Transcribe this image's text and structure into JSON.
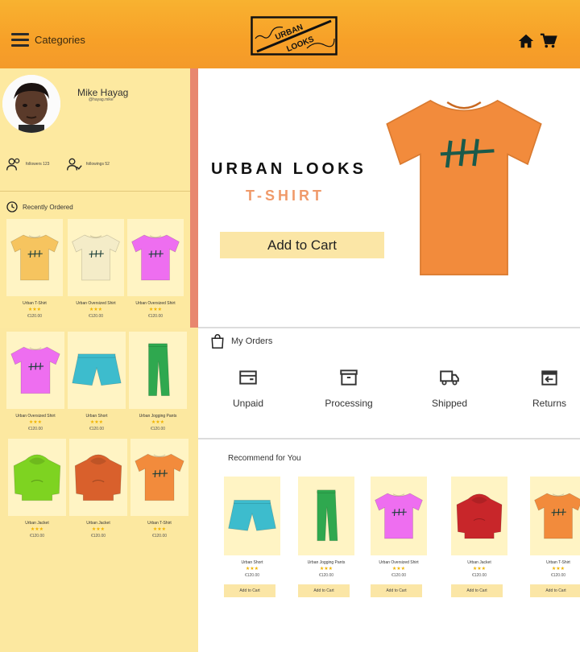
{
  "header": {
    "menu_label": "Categories",
    "logo_text_top": "URBAN",
    "logo_text_bottom": "LOOKS"
  },
  "profile": {
    "name": "Mike Hayag",
    "handle": "@hayag.mike",
    "followers": "followers 123",
    "followings": "followings 52"
  },
  "recently_ordered": {
    "title": "Recently Ordered",
    "items": [
      {
        "name": "Urban T-Shirt",
        "stars": "★★★",
        "price": "€120.00",
        "color": "#f6c45f",
        "kind": "tshirt"
      },
      {
        "name": "Urban Oversized Shirt",
        "stars": "★★★",
        "price": "€120.00",
        "color": "#f4ecc8",
        "kind": "tshirt"
      },
      {
        "name": "Urban Oversized Shirt",
        "stars": "★★★",
        "price": "€120.00",
        "color": "#ee6ef0",
        "kind": "tshirt"
      }
    ]
  },
  "more_items": [
    {
      "name": "Urban Oversized Shirt",
      "stars": "★★★",
      "price": "€120.00",
      "color": "#ee6ef0",
      "kind": "tshirt"
    },
    {
      "name": "Urban Short",
      "stars": "★★★",
      "price": "€120.00",
      "color": "#3dbccd",
      "kind": "shorts"
    },
    {
      "name": "Urban Jogging Pants",
      "stars": "★★★",
      "price": "€120.00",
      "color": "#2fa84f",
      "kind": "pants"
    },
    {
      "name": "Urban Jacket",
      "stars": "★★★",
      "price": "€120.00",
      "color": "#7ed321",
      "kind": "hoodie"
    },
    {
      "name": "Urban Jacket",
      "stars": "★★★",
      "price": "€120.00",
      "color": "#d9602c",
      "kind": "hoodie"
    },
    {
      "name": "Urban T-Shirt",
      "stars": "★★★",
      "price": "€120.00",
      "color": "#f28b3c",
      "kind": "tshirt"
    }
  ],
  "hero": {
    "title": "URBAN LOOKS",
    "subtitle": "T-SHIRT",
    "button": "Add to Cart",
    "shirt_color": "#f28b3c"
  },
  "orders": {
    "title": "My Orders",
    "items": [
      {
        "label": "Unpaid",
        "icon": "wallet-icon"
      },
      {
        "label": "Processing",
        "icon": "box-icon"
      },
      {
        "label": "Shipped",
        "icon": "truck-icon"
      },
      {
        "label": "Returns",
        "icon": "return-icon"
      }
    ]
  },
  "recommend": {
    "title": "Recommend for You",
    "button": "Add to Cart",
    "items": [
      {
        "name": "Urban Short",
        "stars": "★★★",
        "price": "€120.00",
        "color": "#3dbccd",
        "kind": "shorts"
      },
      {
        "name": "Urban Jogging Pants",
        "stars": "★★★",
        "price": "€120.00",
        "color": "#2fa84f",
        "kind": "pants"
      },
      {
        "name": "Urban Oversized Shirt",
        "stars": "★★★",
        "price": "€120.00",
        "color": "#ee6ef0",
        "kind": "tshirt"
      },
      {
        "name": "Urban Jacket",
        "stars": "★★★",
        "price": "€120.00",
        "color": "#c8262a",
        "kind": "hoodie"
      },
      {
        "name": "Urban T-Shirt",
        "stars": "★★★",
        "price": "€120.00",
        "color": "#f28b3c",
        "kind": "tshirt"
      }
    ]
  },
  "colors": {
    "header": "#f7a028",
    "panel": "#fde9a0",
    "accent": "#f09a6a",
    "button": "#fbe6a6"
  }
}
